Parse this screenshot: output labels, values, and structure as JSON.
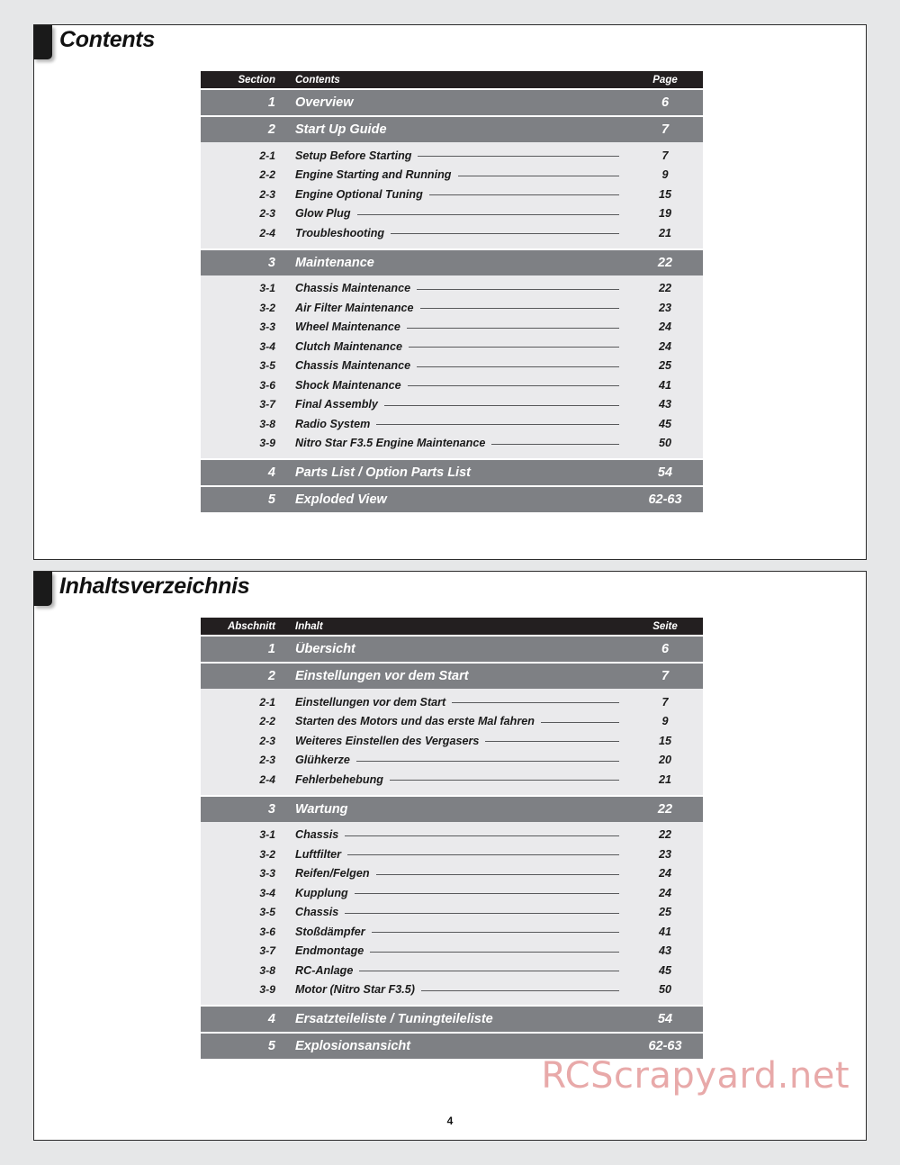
{
  "document": {
    "page_number": "4",
    "watermark": "RCScrapyard.net",
    "accent_colors": {
      "header_bar": "#231f20",
      "section_row": "#7e8084",
      "sub_band": "#eaeaec",
      "watermark": "#e8a9a9"
    }
  },
  "english": {
    "heading": "Contents",
    "columns": {
      "section": "Section",
      "contents": "Contents",
      "page": "Page"
    },
    "rows": [
      {
        "type": "main",
        "section": "1",
        "title": "Overview",
        "page": "6"
      },
      {
        "type": "main",
        "section": "2",
        "title": "Start Up Guide",
        "page": "7"
      },
      {
        "type": "sub",
        "section": "2-1",
        "title": "Setup Before Starting",
        "page": "7"
      },
      {
        "type": "sub",
        "section": "2-2",
        "title": "Engine Starting and Running",
        "page": "9"
      },
      {
        "type": "sub",
        "section": "2-3",
        "title": "Engine Optional Tuning",
        "page": "15"
      },
      {
        "type": "sub",
        "section": "2-3",
        "title": "Glow Plug",
        "page": "19"
      },
      {
        "type": "sub",
        "section": "2-4",
        "title": "Troubleshooting",
        "page": "21"
      },
      {
        "type": "main",
        "section": "3",
        "title": "Maintenance",
        "page": "22"
      },
      {
        "type": "sub",
        "section": "3-1",
        "title": "Chassis Maintenance",
        "page": "22"
      },
      {
        "type": "sub",
        "section": "3-2",
        "title": "Air Filter Maintenance",
        "page": "23"
      },
      {
        "type": "sub",
        "section": "3-3",
        "title": "Wheel Maintenance",
        "page": "24"
      },
      {
        "type": "sub",
        "section": "3-4",
        "title": "Clutch Maintenance",
        "page": "24"
      },
      {
        "type": "sub",
        "section": "3-5",
        "title": "Chassis Maintenance",
        "page": "25"
      },
      {
        "type": "sub",
        "section": "3-6",
        "title": "Shock Maintenance",
        "page": "41"
      },
      {
        "type": "sub",
        "section": "3-7",
        "title": "Final Assembly",
        "page": "43"
      },
      {
        "type": "sub",
        "section": "3-8",
        "title": "Radio System",
        "page": "45"
      },
      {
        "type": "sub",
        "section": "3-9",
        "title": "Nitro Star F3.5 Engine Maintenance",
        "page": "50"
      },
      {
        "type": "main",
        "section": "4",
        "title": "Parts List / Option Parts List",
        "page": "54"
      },
      {
        "type": "main",
        "section": "5",
        "title": "Exploded View",
        "page": "62-63"
      }
    ]
  },
  "german": {
    "heading": "Inhaltsverzeichnis",
    "columns": {
      "section": "Abschnitt",
      "contents": "Inhalt",
      "page": "Seite"
    },
    "rows": [
      {
        "type": "main",
        "section": "1",
        "title": "Übersicht",
        "page": "6"
      },
      {
        "type": "main",
        "section": "2",
        "title": "Einstellungen vor dem Start",
        "page": "7"
      },
      {
        "type": "sub",
        "section": "2-1",
        "title": "Einstellungen vor dem Start",
        "page": "7"
      },
      {
        "type": "sub",
        "section": "2-2",
        "title": "Starten des Motors und das erste Mal fahren",
        "page": "9"
      },
      {
        "type": "sub",
        "section": "2-3",
        "title": "Weiteres Einstellen des Vergasers",
        "page": "15"
      },
      {
        "type": "sub",
        "section": "2-3",
        "title": "Glühkerze",
        "page": "20"
      },
      {
        "type": "sub",
        "section": "2-4",
        "title": "Fehlerbehebung",
        "page": "21"
      },
      {
        "type": "main",
        "section": "3",
        "title": "Wartung",
        "page": "22"
      },
      {
        "type": "sub",
        "section": "3-1",
        "title": "Chassis",
        "page": "22"
      },
      {
        "type": "sub",
        "section": "3-2",
        "title": "Luftfilter",
        "page": "23"
      },
      {
        "type": "sub",
        "section": "3-3",
        "title": "Reifen/Felgen",
        "page": "24"
      },
      {
        "type": "sub",
        "section": "3-4",
        "title": "Kupplung",
        "page": "24"
      },
      {
        "type": "sub",
        "section": "3-5",
        "title": "Chassis",
        "page": "25"
      },
      {
        "type": "sub",
        "section": "3-6",
        "title": "Stoßdämpfer",
        "page": "41"
      },
      {
        "type": "sub",
        "section": "3-7",
        "title": "Endmontage",
        "page": "43"
      },
      {
        "type": "sub",
        "section": "3-8",
        "title": "RC-Anlage",
        "page": "45"
      },
      {
        "type": "sub",
        "section": "3-9",
        "title": "Motor (Nitro Star F3.5)",
        "page": "50"
      },
      {
        "type": "main",
        "section": "4",
        "title": "Ersatzteileliste / Tuningteileliste",
        "page": "54"
      },
      {
        "type": "main",
        "section": "5",
        "title": "Explosionsansicht",
        "page": "62-63"
      }
    ]
  }
}
